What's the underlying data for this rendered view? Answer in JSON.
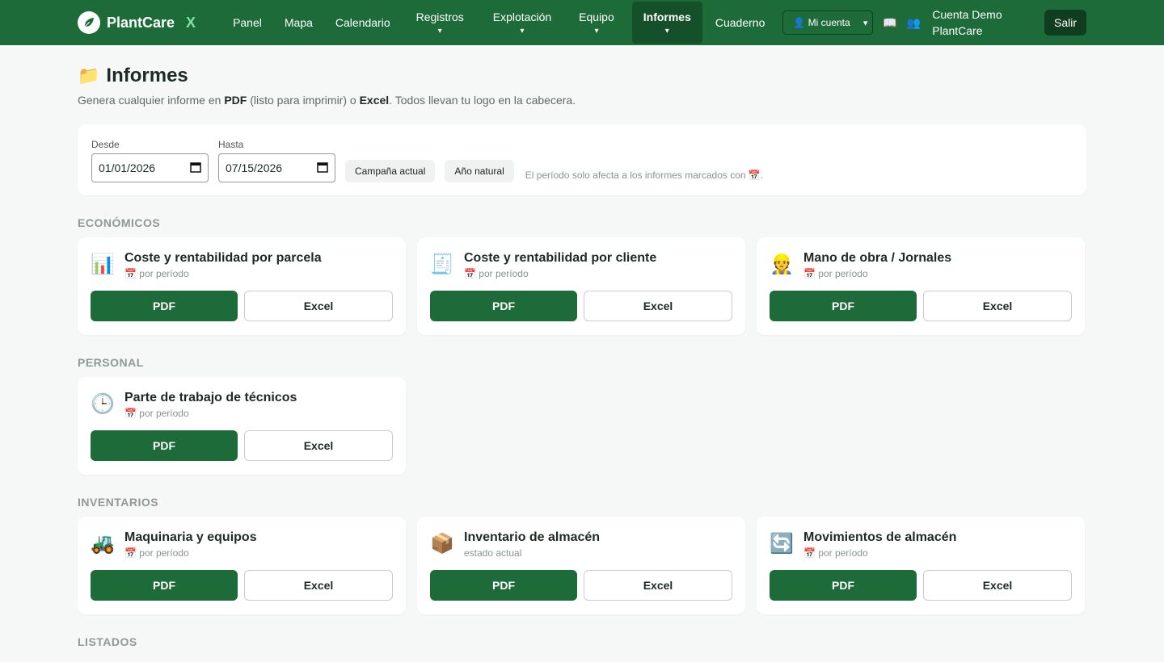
{
  "nav": {
    "brand": "PlantCare",
    "brand_x": "X",
    "items": [
      {
        "label": "Panel",
        "arrow": ""
      },
      {
        "label": "Mapa",
        "arrow": ""
      },
      {
        "label": "Calendario",
        "arrow": ""
      },
      {
        "label": "Registros",
        "arrow": "▾"
      },
      {
        "label": "Explotación",
        "arrow": "▾"
      },
      {
        "label": "Equipo",
        "arrow": "▾"
      },
      {
        "label": "Informes",
        "arrow": "▾"
      },
      {
        "label": "Cuaderno",
        "arrow": ""
      }
    ],
    "account_select": "👤 Mi cuenta",
    "account_select_arrow": "▾",
    "book_icon": "📖",
    "users_icon": "👥",
    "account_name": "Cuenta Demo PlantCare",
    "logout": "Salir"
  },
  "page": {
    "icon": "📁",
    "title": "Informes",
    "desc_1": "Genera cualquier informe en ",
    "desc_pdf": "PDF",
    "desc_2": " (listo para imprimir) o ",
    "desc_excel": "Excel",
    "desc_3": ". Todos llevan tu logo en la cabecera."
  },
  "filter": {
    "from_label": "Desde",
    "from_value": "01/01/2026",
    "to_label": "Hasta",
    "to_value": "07/15/2026",
    "calendar_icon": "▦",
    "btn_campaign": "Campaña actual",
    "btn_year": "Año natural",
    "note": "El período solo afecta a los informes marcados con 📅."
  },
  "sections": [
    {
      "label": "ECONÓMICOS",
      "cards": [
        {
          "icon": "📊",
          "title": "Coste y rentabilidad por parcela",
          "sub": "📅 por período",
          "pdf": "PDF",
          "excel": "Excel"
        },
        {
          "icon": "🧾",
          "title": "Coste y rentabilidad por cliente",
          "sub": "📅 por período",
          "pdf": "PDF",
          "excel": "Excel"
        },
        {
          "icon": "👷",
          "title": "Mano de obra / Jornales",
          "sub": "📅 por período",
          "pdf": "PDF",
          "excel": "Excel"
        }
      ]
    },
    {
      "label": "PERSONAL",
      "cards": [
        {
          "icon": "🕒",
          "title": "Parte de trabajo de técnicos",
          "sub": "📅 por período",
          "pdf": "PDF",
          "excel": "Excel"
        }
      ]
    },
    {
      "label": "INVENTARIOS",
      "cards": [
        {
          "icon": "🚜",
          "title": "Maquinaria y equipos",
          "sub": "📅 por período",
          "pdf": "PDF",
          "excel": "Excel"
        },
        {
          "icon": "📦",
          "title": "Inventario de almacén",
          "sub": "estado actual",
          "pdf": "PDF",
          "excel": "Excel"
        },
        {
          "icon": "🔄",
          "title": "Movimientos de almacén",
          "sub": "📅 por período",
          "pdf": "PDF",
          "excel": "Excel"
        }
      ]
    },
    {
      "label": "LISTADOS",
      "cards": []
    }
  ]
}
